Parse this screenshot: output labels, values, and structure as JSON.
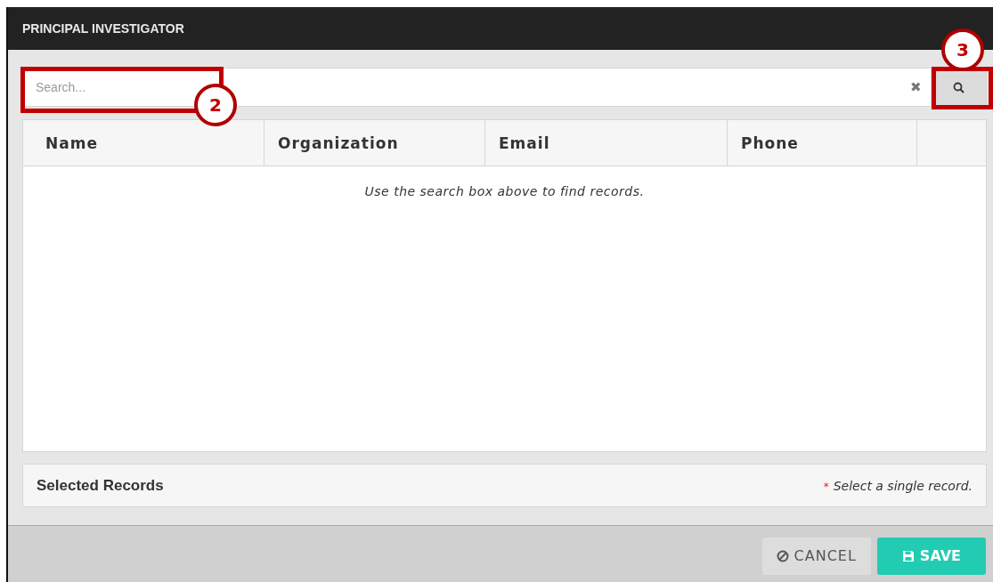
{
  "dialog": {
    "title": "PRINCIPAL INVESTIGATOR"
  },
  "search": {
    "placeholder": "Search...",
    "clear_icon": "✖"
  },
  "table": {
    "columns": [
      "Name",
      "Organization",
      "Email",
      "Phone",
      ""
    ],
    "empty_message": "Use the search box above to find records."
  },
  "selected_records": {
    "title": "Selected Records",
    "required_mark": "*",
    "hint": "Select a single record."
  },
  "buttons": [
    {
      "kind": "cancel",
      "label": "CANCEL"
    },
    {
      "kind": "save",
      "label": "SAVE"
    }
  ],
  "callouts": [
    {
      "kind": "search-field",
      "label": "2"
    },
    {
      "kind": "search-button",
      "label": "3"
    }
  ]
}
